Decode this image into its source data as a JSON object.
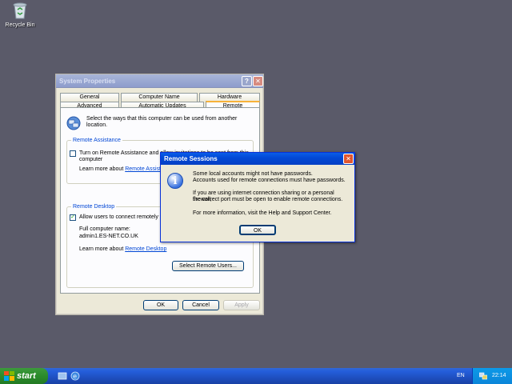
{
  "desktop": {
    "recycle_bin_label": "Recycle Bin"
  },
  "system_properties": {
    "title": "System Properties",
    "help_glyph": "?",
    "close_glyph": "✕",
    "tabs_row1": [
      "General",
      "Computer Name",
      "Hardware"
    ],
    "tabs_row2": [
      "Advanced",
      "Automatic Updates",
      "Remote"
    ],
    "intro": "Select the ways that this computer can be used from another location.",
    "remote_assistance": {
      "legend": "Remote Assistance",
      "checkbox_label_line1": "Turn on Remote Assistance and allow invitations to be sent from this",
      "checkbox_label_line2": "computer",
      "learn_more_prefix": "Learn more about ",
      "learn_more_link": "Remote Assistance"
    },
    "remote_desktop": {
      "legend": "Remote Desktop",
      "checkbox_label": "Allow users to connect remotely to this computer",
      "checkbox_mark": "✓",
      "full_name_label": "Full computer name:",
      "full_name_value": "admin1.ES-NET.CO.UK",
      "learn_more_prefix": "Learn more about ",
      "learn_more_link": "Remote Desktop",
      "select_users_button": "Select Remote Users..."
    },
    "ok_button": "OK",
    "cancel_button": "Cancel",
    "apply_button": "Apply"
  },
  "remote_sessions": {
    "title": "Remote Sessions",
    "close_glyph": "✕",
    "info_glyph": "i",
    "para1_line1": "Some local accounts might not have passwords.",
    "para1_line2": "Accounts used for remote connections must have passwords.",
    "para2_line1": "If you are using internet connection sharing or a personal firewall,",
    "para2_line2": "the correct port must be open to enable remote connections.",
    "para3": "For more information, visit the Help and Support Center.",
    "ok_button": "OK"
  },
  "taskbar": {
    "start_label": "start",
    "language": "EN",
    "clock": "22:14"
  },
  "colors": {
    "desktop": "#5a5a69",
    "accent_link": "#0046d5",
    "titlebar_active": "#0a5ee8",
    "start_green": "#2b8b2b"
  }
}
